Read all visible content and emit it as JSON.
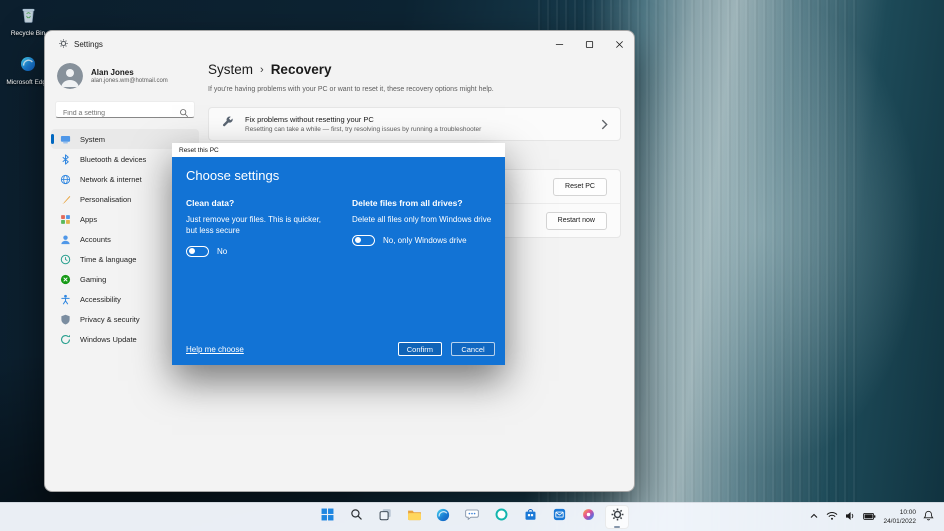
{
  "desktop": {
    "icons": [
      {
        "label": "Recycle Bin"
      },
      {
        "label": "Microsoft Edge"
      }
    ]
  },
  "window": {
    "title": "Settings",
    "profile": {
      "name": "Alan Jones",
      "email": "alan.jones.wm@hotmail.com"
    },
    "search_placeholder": "Find a setting",
    "sidebar": [
      {
        "label": "System"
      },
      {
        "label": "Bluetooth & devices"
      },
      {
        "label": "Network & internet"
      },
      {
        "label": "Personalisation"
      },
      {
        "label": "Apps"
      },
      {
        "label": "Accounts"
      },
      {
        "label": "Time & language"
      },
      {
        "label": "Gaming"
      },
      {
        "label": "Accessibility"
      },
      {
        "label": "Privacy & security"
      },
      {
        "label": "Windows Update"
      }
    ]
  },
  "page": {
    "breadcrumb_root": "System",
    "breadcrumb_separator": "›",
    "title": "Recovery",
    "subtitle": "If you're having problems with your PC or want to reset it, these recovery options might help.",
    "fix_card": {
      "title": "Fix problems without resetting your PC",
      "description": "Resetting can take a while — first, try resolving issues by running a troubleshooter"
    },
    "reset_button": "Reset PC",
    "restart_button": "Restart now"
  },
  "dialog": {
    "title": "Reset this PC",
    "heading": "Choose settings",
    "clean": {
      "title": "Clean data?",
      "description": "Just remove your files. This is quicker, but less secure",
      "toggle_label": "No"
    },
    "drives": {
      "title": "Delete files from all drives?",
      "description": "Delete all files only from Windows drive",
      "toggle_label": "No, only Windows drive"
    },
    "help_link": "Help me choose",
    "confirm_button": "Confirm",
    "cancel_button": "Cancel"
  },
  "taskbar": {
    "time": "10:00",
    "date": "24/01/2022"
  },
  "colors": {
    "accent": "#0067c0",
    "dialog_blue": "#1273d5"
  }
}
